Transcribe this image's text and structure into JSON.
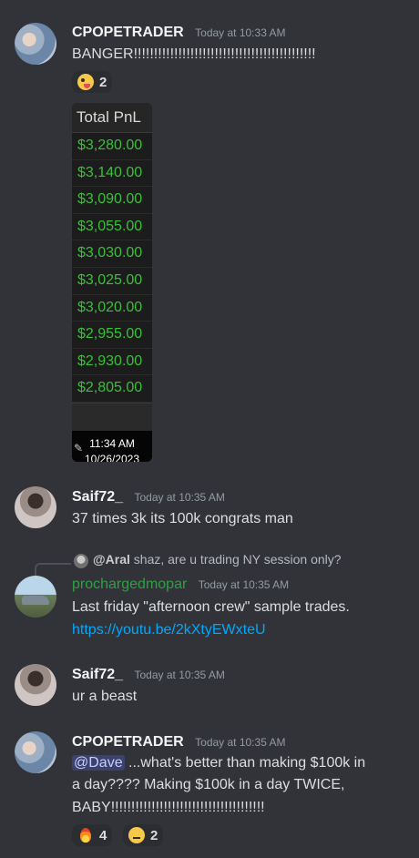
{
  "messages": [
    {
      "author": "CPOPETRADER",
      "timestamp": "Today at 10:33 AM",
      "text": "BANGER!!!!!!!!!!!!!!!!!!!!!!!!!!!!!!!!!!!!!!!!!!!!!",
      "reactions": [
        {
          "emoji": "zany-face-emoji",
          "count": "2"
        }
      ],
      "attachment": {
        "title": "Total PnL",
        "rows": [
          "$3,280.00",
          "$3,140.00",
          "$3,090.00",
          "$3,055.00",
          "$3,030.00",
          "$3,025.00",
          "$3,020.00",
          "$2,955.00",
          "$2,930.00",
          "$2,805.00"
        ],
        "time": "11:34 AM",
        "date": "10/26/2023"
      }
    },
    {
      "author": "Saif72_",
      "timestamp": "Today at 10:35 AM",
      "text": "37 times 3k its 100k congrats man"
    },
    {
      "author": "prochargedmopar",
      "timestamp": "Today at 10:35 AM",
      "reply": {
        "user": "@Aral",
        "text": "shaz, are u trading NY session only?"
      },
      "text": "Last friday \"afternoon crew\" sample trades.",
      "link": "https://youtu.be/2kXtyEWxteU"
    },
    {
      "author": "Saif72_",
      "timestamp": "Today at 10:35 AM",
      "text": "ur a beast"
    },
    {
      "author": "CPOPETRADER",
      "timestamp": "Today at 10:35 AM",
      "mention": "@Dave",
      "text_line1": " ...what's better than making $100k in",
      "text_line2": "a day????  Making $100k in a day TWICE,",
      "text_line3": "BABY!!!!!!!!!!!!!!!!!!!!!!!!!!!!!!!!!!!!!!",
      "reactions": [
        {
          "emoji": "fire-emoji",
          "count": "4"
        },
        {
          "emoji": "thinking-face-emoji",
          "count": "2"
        }
      ]
    }
  ]
}
